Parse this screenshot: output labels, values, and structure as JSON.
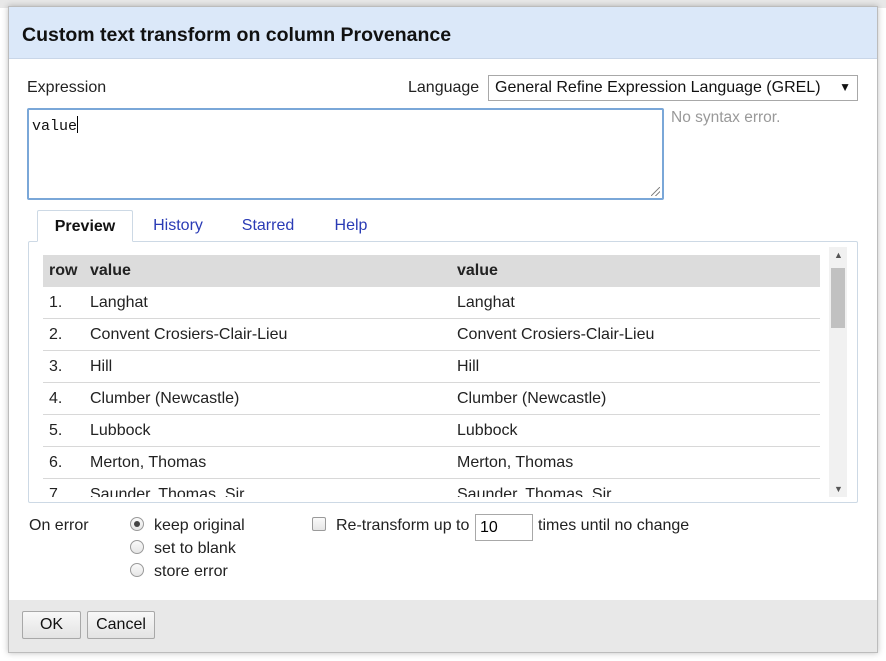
{
  "dialog": {
    "title": "Custom text transform on column Provenance"
  },
  "expression": {
    "label": "Expression",
    "value": "value",
    "syntax_status": "No syntax error."
  },
  "language": {
    "label": "Language",
    "selected": "General Refine Expression Language (GREL)"
  },
  "tabs": [
    {
      "label": "Preview",
      "active": true
    },
    {
      "label": "History"
    },
    {
      "label": "Starred"
    },
    {
      "label": "Help"
    }
  ],
  "preview": {
    "headers": [
      "row",
      "value",
      "value"
    ],
    "rows": [
      {
        "row": "1.",
        "value": "Langhat",
        "new": "Langhat"
      },
      {
        "row": "2.",
        "value": "Convent Crosiers-Clair-Lieu",
        "new": "Convent Crosiers-Clair-Lieu"
      },
      {
        "row": "3.",
        "value": "Hill",
        "new": "Hill"
      },
      {
        "row": "4.",
        "value": "Clumber (Newcastle)",
        "new": "Clumber (Newcastle)"
      },
      {
        "row": "5.",
        "value": "Lubbock",
        "new": "Lubbock"
      },
      {
        "row": "6.",
        "value": "Merton, Thomas",
        "new": "Merton, Thomas"
      },
      {
        "row": "7.",
        "value": "Saunder, Thomas, Sir",
        "new": "Saunder, Thomas, Sir"
      }
    ]
  },
  "on_error": {
    "label": "On error",
    "options": [
      "keep original",
      "set to blank",
      "store error"
    ],
    "selected": "keep original"
  },
  "retransform": {
    "label_before": "Re-transform up to",
    "value": "10",
    "label_after": "times until no change",
    "checked": false
  },
  "buttons": {
    "ok": "OK",
    "cancel": "Cancel"
  }
}
